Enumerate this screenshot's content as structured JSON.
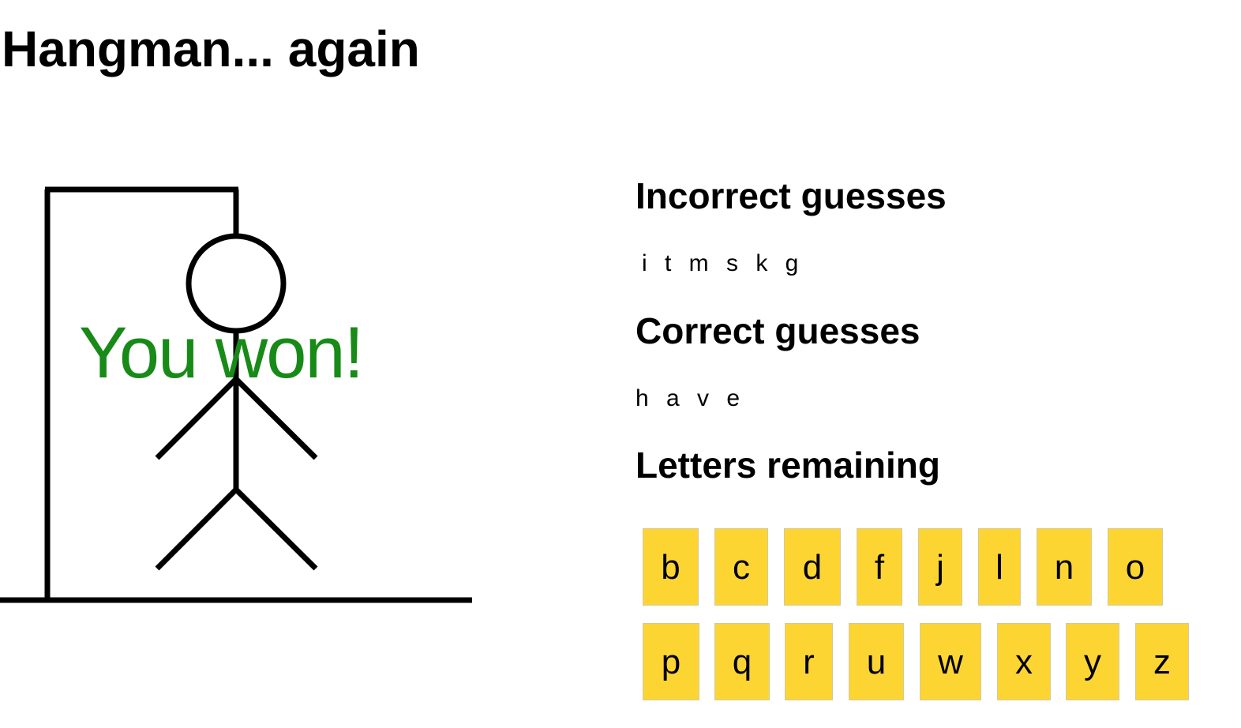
{
  "title": "Hangman... again",
  "game": {
    "status_message": "You won!",
    "status_color": "#178a17"
  },
  "incorrect": {
    "heading": "Incorrect guesses",
    "letters": "i t m s k g"
  },
  "correct": {
    "heading": "Correct guesses",
    "letters": "h a v e"
  },
  "remaining": {
    "heading": "Letters remaining",
    "letters": [
      "b",
      "c",
      "d",
      "f",
      "j",
      "l",
      "n",
      "o",
      "p",
      "q",
      "r",
      "u",
      "w",
      "x",
      "y",
      "z"
    ]
  },
  "colors": {
    "tile": "#fdd533",
    "drawing": "#000000"
  },
  "icons": {
    "gallows": "gallows-icon",
    "stick_figure": "stick-figure-icon"
  }
}
